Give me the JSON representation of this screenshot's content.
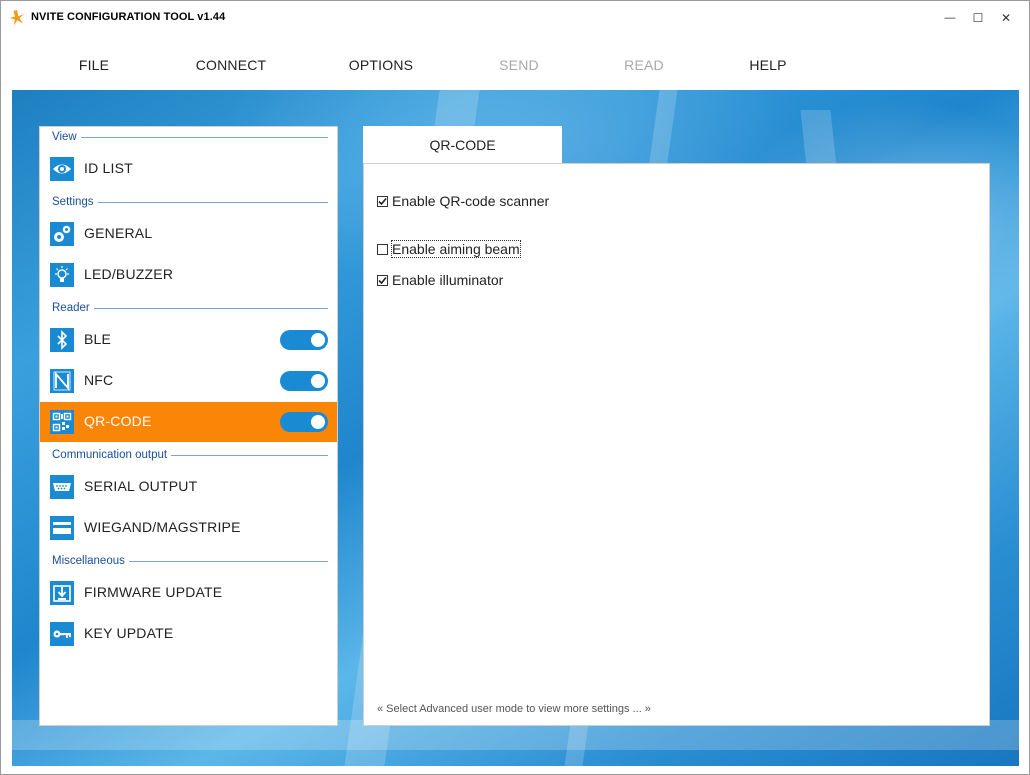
{
  "window": {
    "title": "NVITE CONFIGURATION TOOL v1.44",
    "controls": {
      "minimize": "—",
      "maximize": "☐",
      "close": "✕"
    }
  },
  "menu": {
    "file": "FILE",
    "connect": "CONNECT",
    "options": "OPTIONS",
    "send": "SEND",
    "read": "READ",
    "help": "HELP"
  },
  "sidebar": {
    "sections": {
      "view": "View",
      "settings": "Settings",
      "reader": "Reader",
      "communication": "Communication output",
      "misc": "Miscellaneous"
    },
    "items": {
      "id_list": "ID LIST",
      "general": "GENERAL",
      "led_buzzer": "LED/BUZZER",
      "ble": "BLE",
      "nfc": "NFC",
      "qr_code": "QR-CODE",
      "serial_output": "SERIAL OUTPUT",
      "wiegand": "WIEGAND/MAGSTRIPE",
      "firmware_update": "FIRMWARE UPDATE",
      "key_update": "KEY UPDATE"
    },
    "toggles": {
      "ble": true,
      "nfc": true,
      "qr_code": true
    },
    "active_item": "QR-CODE"
  },
  "panel": {
    "tab_label": "QR-CODE",
    "options": {
      "enable_scanner": {
        "label": "Enable QR-code scanner",
        "checked": true
      },
      "enable_aiming_beam": {
        "label": "Enable aiming beam",
        "checked": false
      },
      "enable_illuminator": {
        "label": "Enable illuminator",
        "checked": true
      }
    },
    "footer": "« Select Advanced user mode to view more settings ... »"
  },
  "colors": {
    "accent": "#1a8bd3",
    "active": "#fa8607",
    "section_text": "#1a4f9c"
  }
}
